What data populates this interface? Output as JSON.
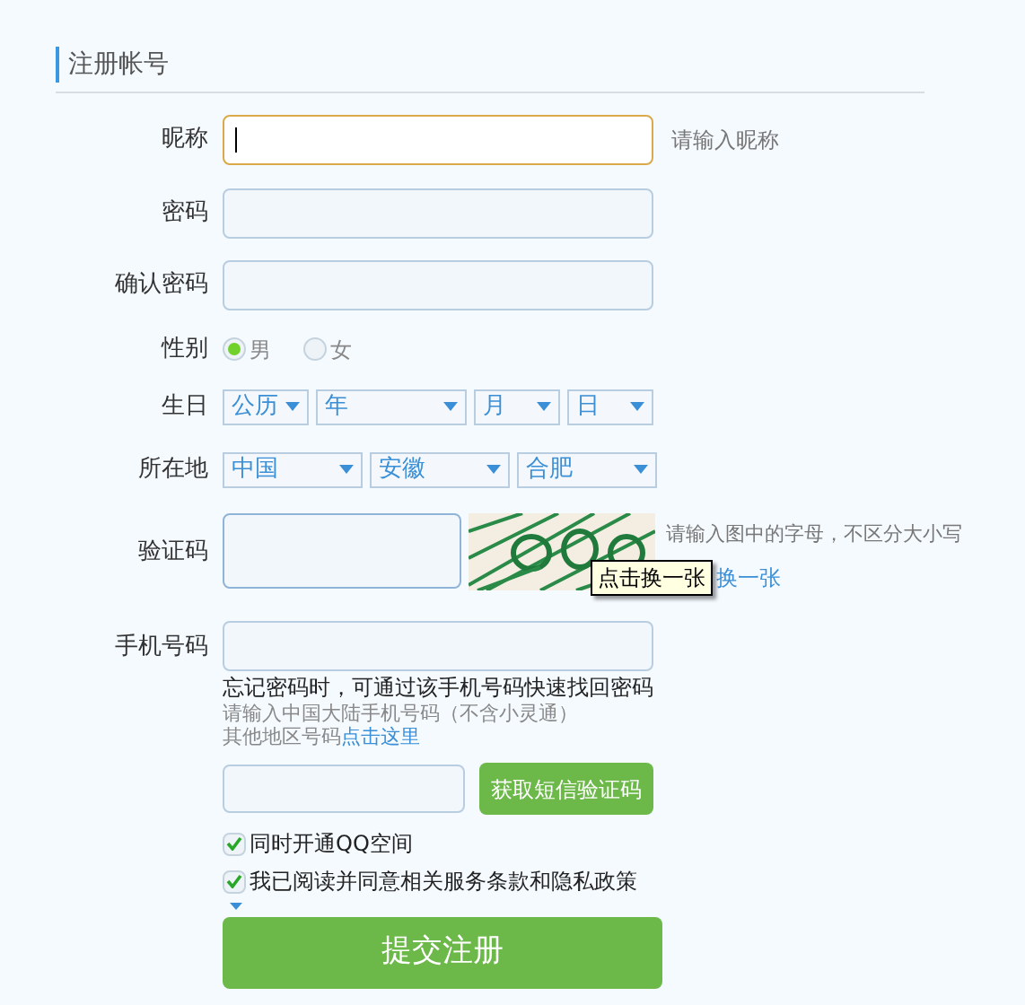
{
  "section_title": "注册帐号",
  "nickname": {
    "label": "昵称",
    "hint": "请输入昵称",
    "focused": true
  },
  "password": {
    "label": "密码"
  },
  "confirm_password": {
    "label": "确认密码"
  },
  "gender": {
    "label": "性别",
    "options": [
      {
        "label": "男",
        "selected": true
      },
      {
        "label": "女",
        "selected": false
      }
    ]
  },
  "birthday": {
    "label": "生日",
    "selects": [
      {
        "value": "公历"
      },
      {
        "value": "年"
      },
      {
        "value": "月"
      },
      {
        "value": "日"
      }
    ]
  },
  "location": {
    "label": "所在地",
    "selects": [
      {
        "value": "中国"
      },
      {
        "value": "安徽"
      },
      {
        "value": "合肥"
      }
    ]
  },
  "captcha": {
    "label": "验证码",
    "hint": "请输入图中的字母，不区分大小写",
    "refresh_link": "换一张",
    "tooltip": "点击换一张"
  },
  "phone": {
    "label": "手机号码",
    "note": "忘记密码时，可通过该手机号码快速找回密码",
    "hint": "请输入中国大陆手机号码（不含小灵通）",
    "other_region": "其他地区号码",
    "other_region_link": "点击这里",
    "sms_button": "获取短信验证码"
  },
  "agreements": [
    {
      "label": "同时开通QQ空间",
      "checked": true
    },
    {
      "label": "我已阅读并同意相关服务条款和隐私政策",
      "checked": true
    }
  ],
  "submit": "提交注册"
}
